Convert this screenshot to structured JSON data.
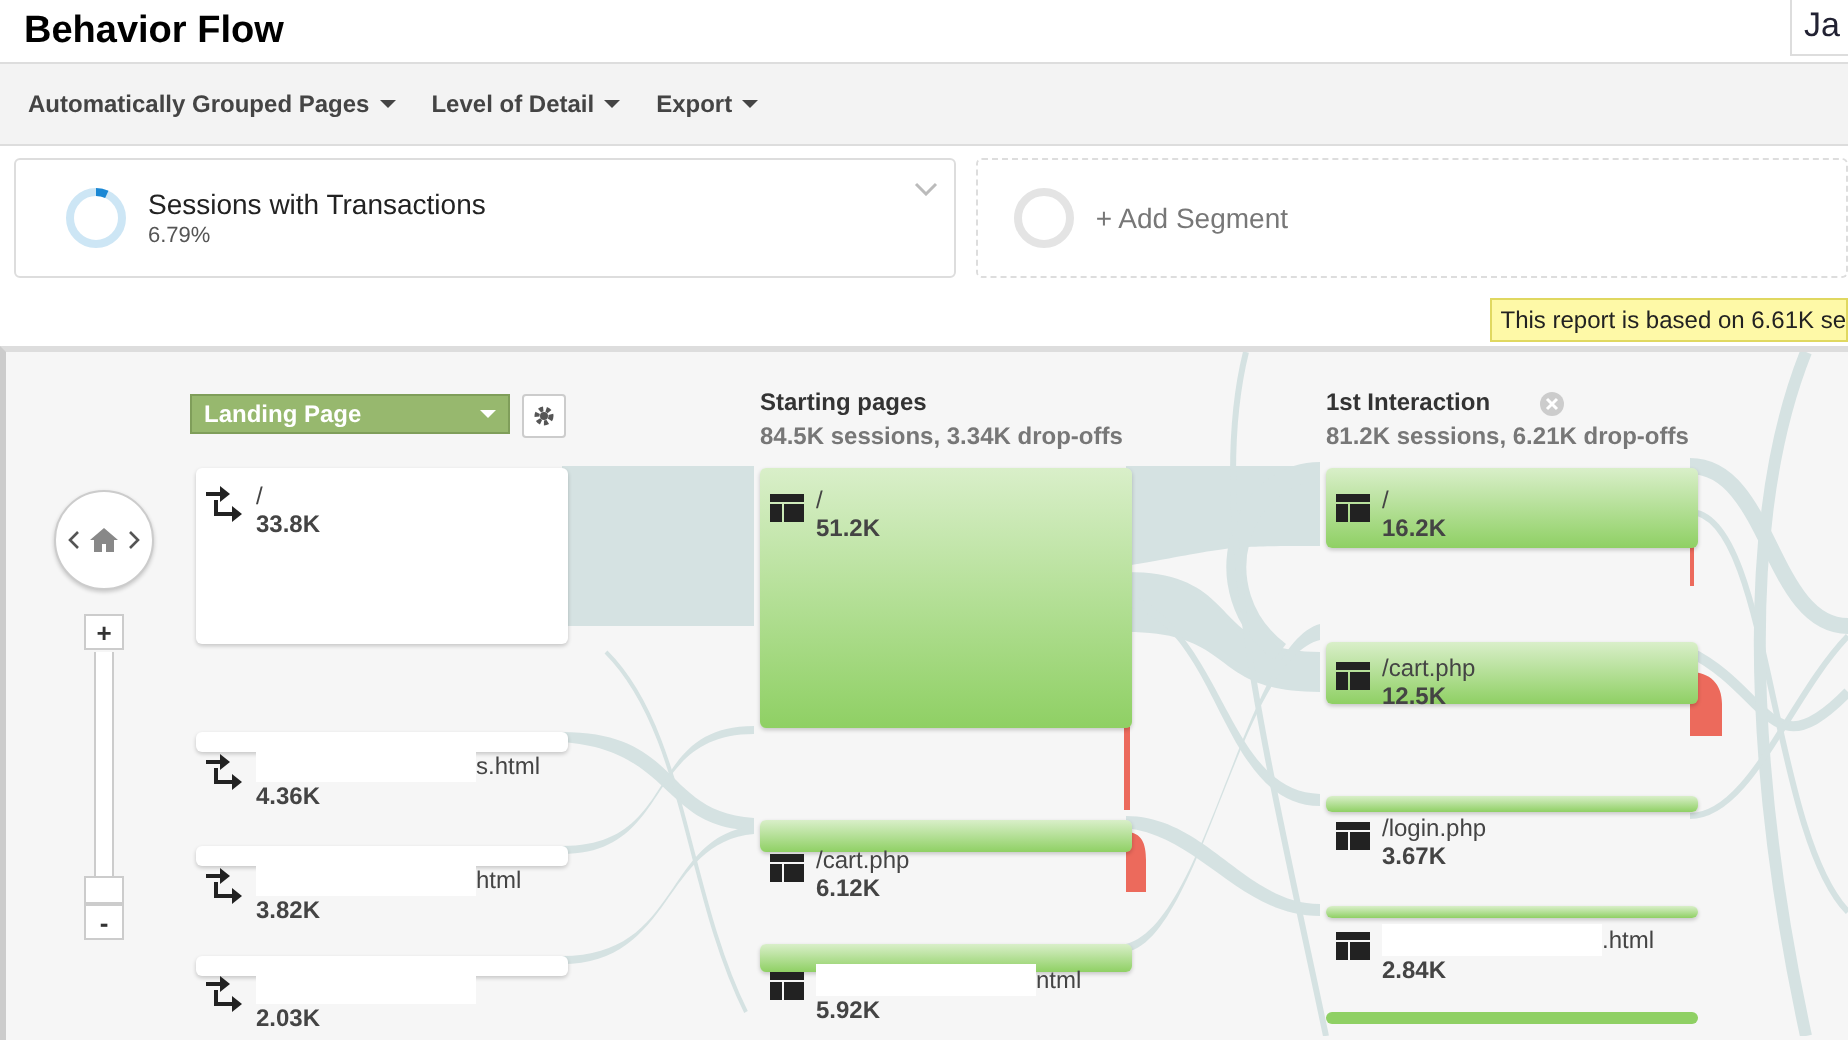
{
  "title": "Behavior Flow",
  "date_range": "Ja",
  "toolbar": [
    {
      "label": "Automatically Grouped Pages"
    },
    {
      "label": "Level of Detail"
    },
    {
      "label": "Export"
    }
  ],
  "segments": [
    {
      "kind": "segment",
      "name": "Sessions with Transactions",
      "value": "6.79%",
      "level": 0.0679
    },
    {
      "kind": "add",
      "name": "+ Add Segment"
    }
  ],
  "notice": "This report is based on 6.61K se",
  "zoom": {
    "level": 0,
    "zoom_in": "+",
    "zoom_out": "-"
  },
  "dimension": {
    "label": "Landing Page"
  },
  "columns": [
    {
      "kind": "landing",
      "nodes": [
        {
          "label": "/",
          "value": "33.8K"
        },
        {
          "label": "s.html",
          "value": "4.36K",
          "redacted": true
        },
        {
          "label": "html",
          "value": "3.82K",
          "redacted": true
        },
        {
          "value": "2.03K",
          "redacted": true
        }
      ]
    },
    {
      "kind": "page",
      "title": "Starting pages",
      "summary": "84.5K sessions, 3.34K drop-offs",
      "nodes": [
        {
          "label": "/",
          "value": "51.2K"
        },
        {
          "label": "/cart.php",
          "value": "6.12K"
        },
        {
          "label": "ntml",
          "value": "5.92K",
          "redacted": true
        }
      ]
    },
    {
      "kind": "page",
      "title": "1st Interaction",
      "summary": "81.2K sessions, 6.21K drop-offs",
      "closable": true,
      "nodes": [
        {
          "label": "/",
          "value": "16.2K"
        },
        {
          "label": "/cart.php",
          "value": "12.5K"
        },
        {
          "label": "/login.php",
          "value": "3.67K"
        },
        {
          "label": ".html",
          "value": "2.84K",
          "redacted": true
        }
      ]
    }
  ]
}
